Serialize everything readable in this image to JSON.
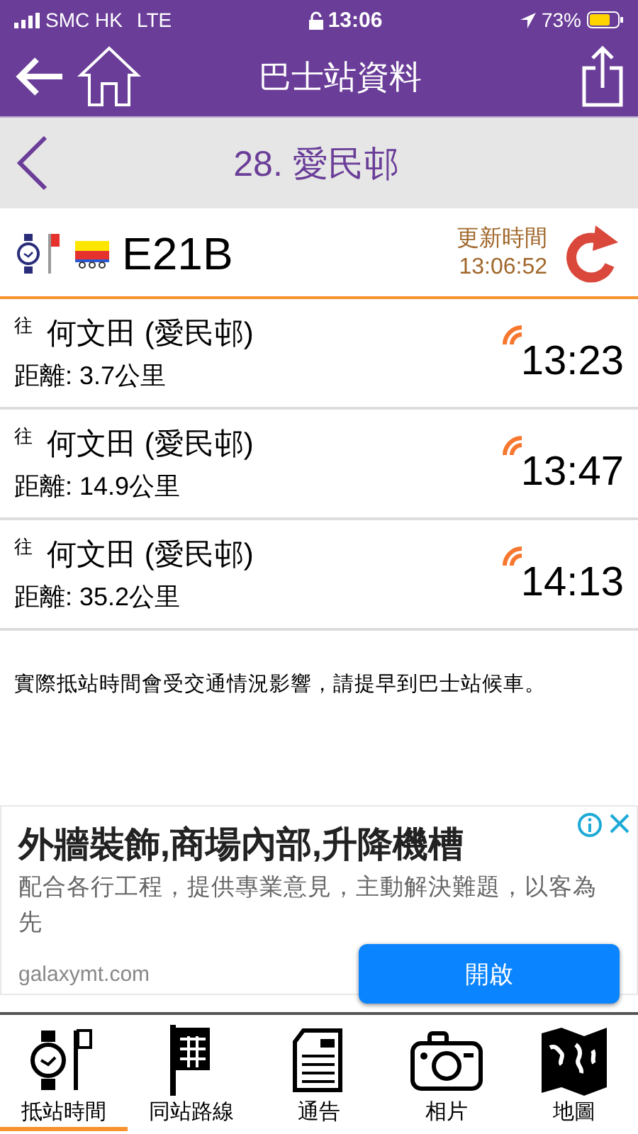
{
  "status_bar": {
    "carrier": "SMC HK",
    "network": "LTE",
    "time": "13:06",
    "battery": "73%"
  },
  "nav": {
    "title": "巴士站資料"
  },
  "station": {
    "name": "28. 愛民邨"
  },
  "route": {
    "number": "E21B",
    "update_label": "更新時間",
    "update_time": "13:06:52"
  },
  "arrivals": [
    {
      "prefix": "往",
      "destination": "何文田 (愛民邨)",
      "distance": "距離: 3.7公里",
      "time": "13:23"
    },
    {
      "prefix": "往",
      "destination": "何文田 (愛民邨)",
      "distance": "距離: 14.9公里",
      "time": "13:47"
    },
    {
      "prefix": "往",
      "destination": "何文田 (愛民邨)",
      "distance": "距離: 35.2公里",
      "time": "14:13"
    }
  ],
  "notice": "實際抵站時間會受交通情況影響，請提早到巴士站候車。",
  "ad": {
    "headline": "外牆裝飾,商場內部,升降機槽",
    "body": "配合各行工程，提供專業意見，主動解決難題，以客為先",
    "domain": "galaxymt.com",
    "button": "開啟"
  },
  "tabs": [
    {
      "label": "抵站時間",
      "selected": true
    },
    {
      "label": "同站路線",
      "selected": false
    },
    {
      "label": "通告",
      "selected": false
    },
    {
      "label": "相片",
      "selected": false
    },
    {
      "label": "地圖",
      "selected": false
    }
  ]
}
